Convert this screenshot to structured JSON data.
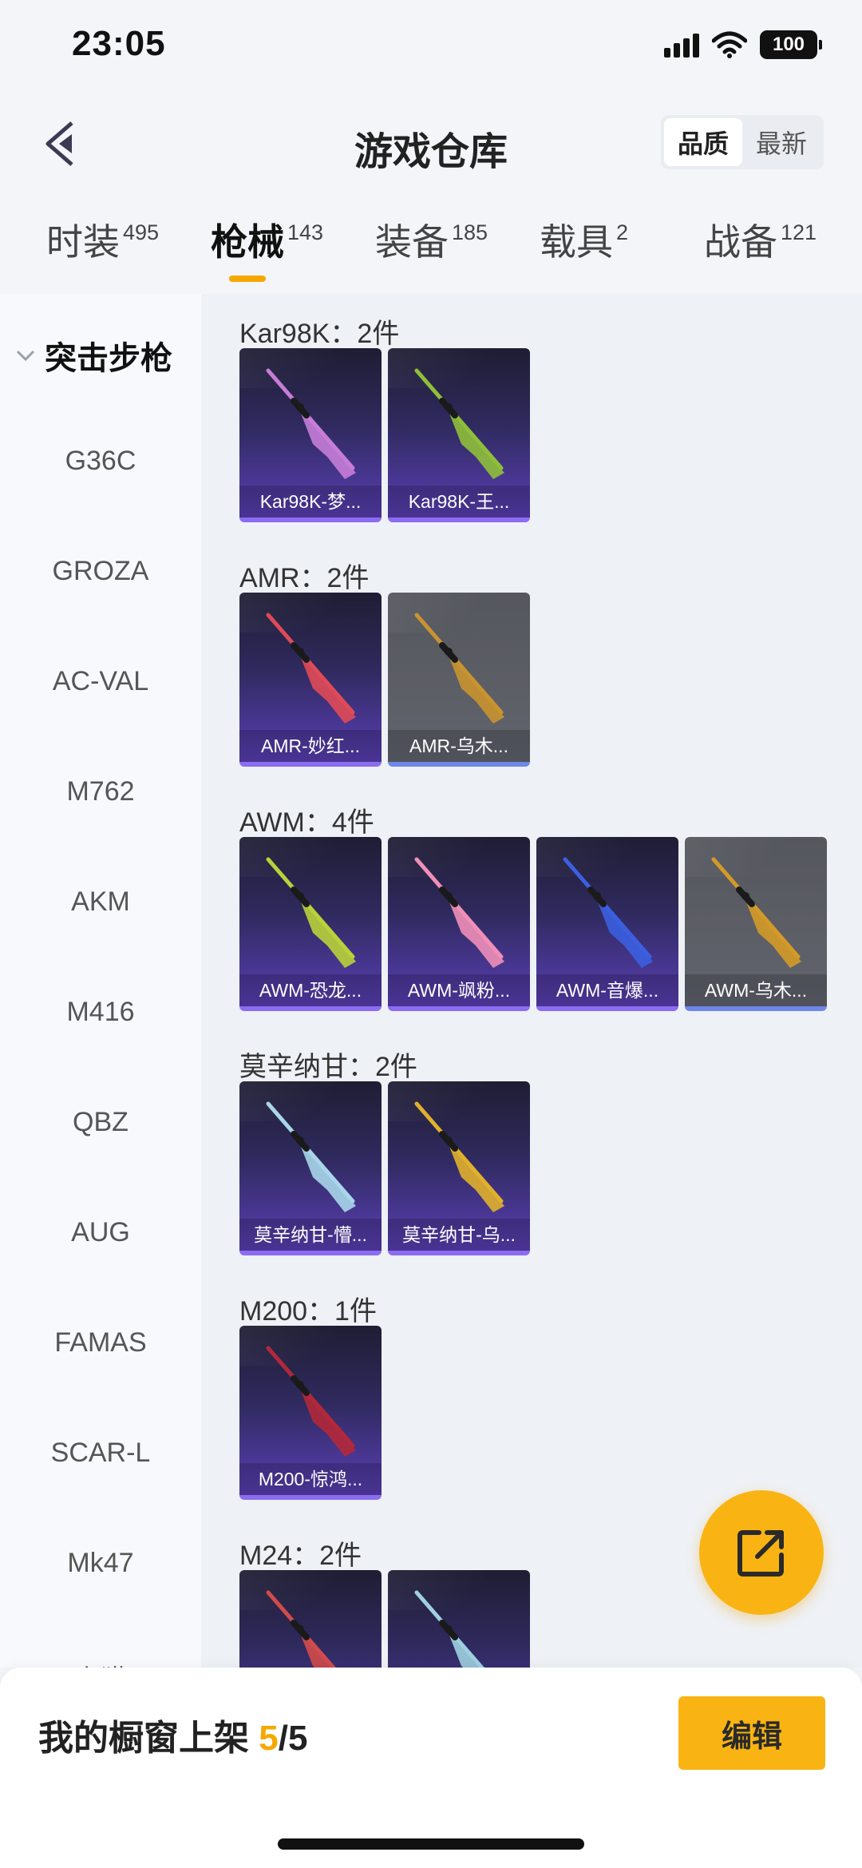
{
  "status_bar": {
    "time": "23:05",
    "battery": "100"
  },
  "nav": {
    "title": "游戏仓库",
    "sort_options": [
      "品质",
      "最新"
    ],
    "sort_active": "品质"
  },
  "tabs": [
    {
      "label": "时装",
      "count": "495"
    },
    {
      "label": "枪械",
      "count": "143"
    },
    {
      "label": "装备",
      "count": "185"
    },
    {
      "label": "载具",
      "count": "2"
    },
    {
      "label": "战备",
      "count": "121"
    }
  ],
  "active_tab": "枪械",
  "sidebar": {
    "header": "突击步枪",
    "items": [
      "G36C",
      "GROZA",
      "AC-VAL",
      "M762",
      "AKM",
      "M416",
      "QBZ",
      "AUG",
      "FAMAS",
      "SCAR-L",
      "Mk47",
      "蜜獾"
    ]
  },
  "groups": [
    {
      "title": "Kar98K：2件",
      "items": [
        {
          "name": "Kar98K-梦...",
          "tint": "#c77dd8",
          "style": "purple"
        },
        {
          "name": "Kar98K-王...",
          "tint": "#8fbf3a",
          "style": "purple"
        }
      ]
    },
    {
      "title": "AMR：2件",
      "items": [
        {
          "name": "AMR-妙红...",
          "tint": "#e04a58",
          "style": "purple"
        },
        {
          "name": "AMR-乌木...",
          "tint": "#c9932f",
          "style": "grey"
        }
      ]
    },
    {
      "title": "AWM：4件",
      "items": [
        {
          "name": "AWM-恐龙...",
          "tint": "#b9d23a",
          "style": "purple"
        },
        {
          "name": "AWM-飒粉...",
          "tint": "#f08fb8",
          "style": "purple"
        },
        {
          "name": "AWM-音爆...",
          "tint": "#3b5fe0",
          "style": "purple"
        },
        {
          "name": "AWM-乌木...",
          "tint": "#d39a28",
          "style": "grey"
        }
      ]
    },
    {
      "title": "莫辛纳甘：2件",
      "items": [
        {
          "name": "莫辛纳甘-懵...",
          "tint": "#a9d6ea",
          "style": "purple"
        },
        {
          "name": "莫辛纳甘-乌...",
          "tint": "#e0b02c",
          "style": "purple"
        }
      ]
    },
    {
      "title": "M200：1件",
      "items": [
        {
          "name": "M200-惊鸿...",
          "tint": "#b2283a",
          "style": "purple"
        }
      ]
    },
    {
      "title": "M24：2件",
      "items": [
        {
          "name": "",
          "tint": "#d24b4b",
          "style": "purple"
        },
        {
          "name": "",
          "tint": "#9fd0e0",
          "style": "purple"
        }
      ]
    }
  ],
  "bottom": {
    "label": "我的橱窗上架 ",
    "count": "5",
    "total": "/5",
    "edit_label": "编辑"
  },
  "colors": {
    "accent": "#f9b413",
    "card_purple": "#5a3fb5",
    "card_grey": "#5d5f66"
  }
}
